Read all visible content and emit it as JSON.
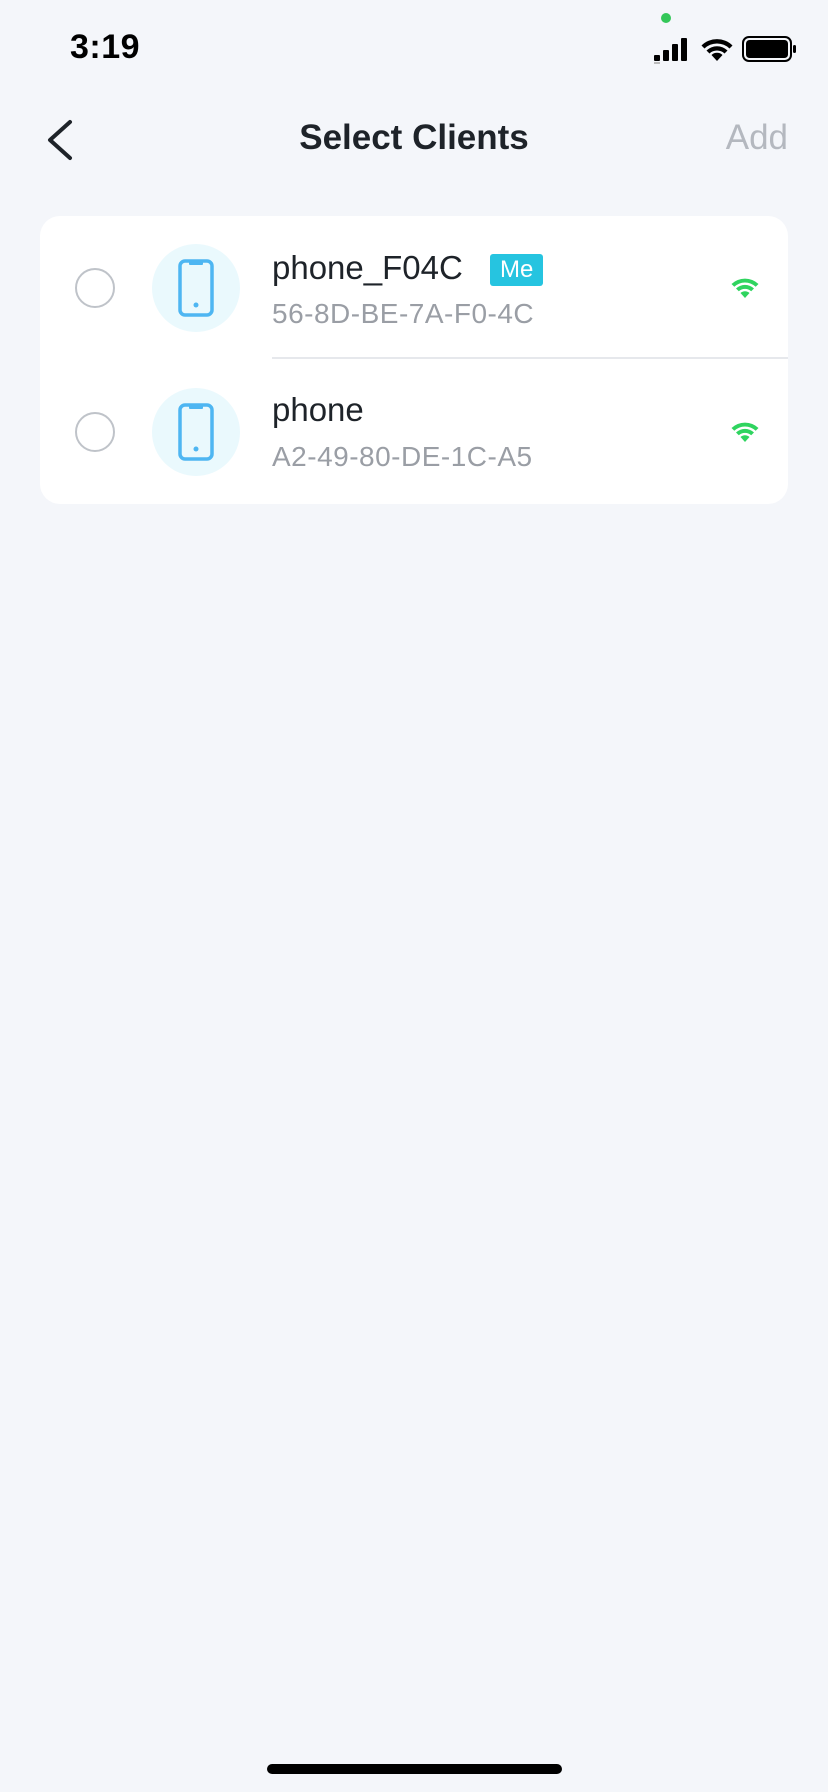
{
  "status_bar": {
    "time": "3:19"
  },
  "nav": {
    "title": "Select Clients",
    "add_label": "Add"
  },
  "clients": [
    {
      "name": "phone_F04C",
      "mac": "56-8D-BE-7A-F0-4C",
      "badge": "Me",
      "selected": false,
      "icon": "phone-icon",
      "signal_icon": "wifi-signal-icon"
    },
    {
      "name": "phone",
      "mac": "A2-49-80-DE-1C-A5",
      "selected": false,
      "icon": "phone-icon",
      "signal_icon": "wifi-signal-icon"
    }
  ],
  "colors": {
    "background": "#F4F6FA",
    "accent_badge": "#26C4E0",
    "signal_green": "#2FD45F",
    "device_icon_blue": "#4EB6F2",
    "avatar_bg": "#EAF9FD",
    "disabled_text": "#B4B8BF"
  }
}
